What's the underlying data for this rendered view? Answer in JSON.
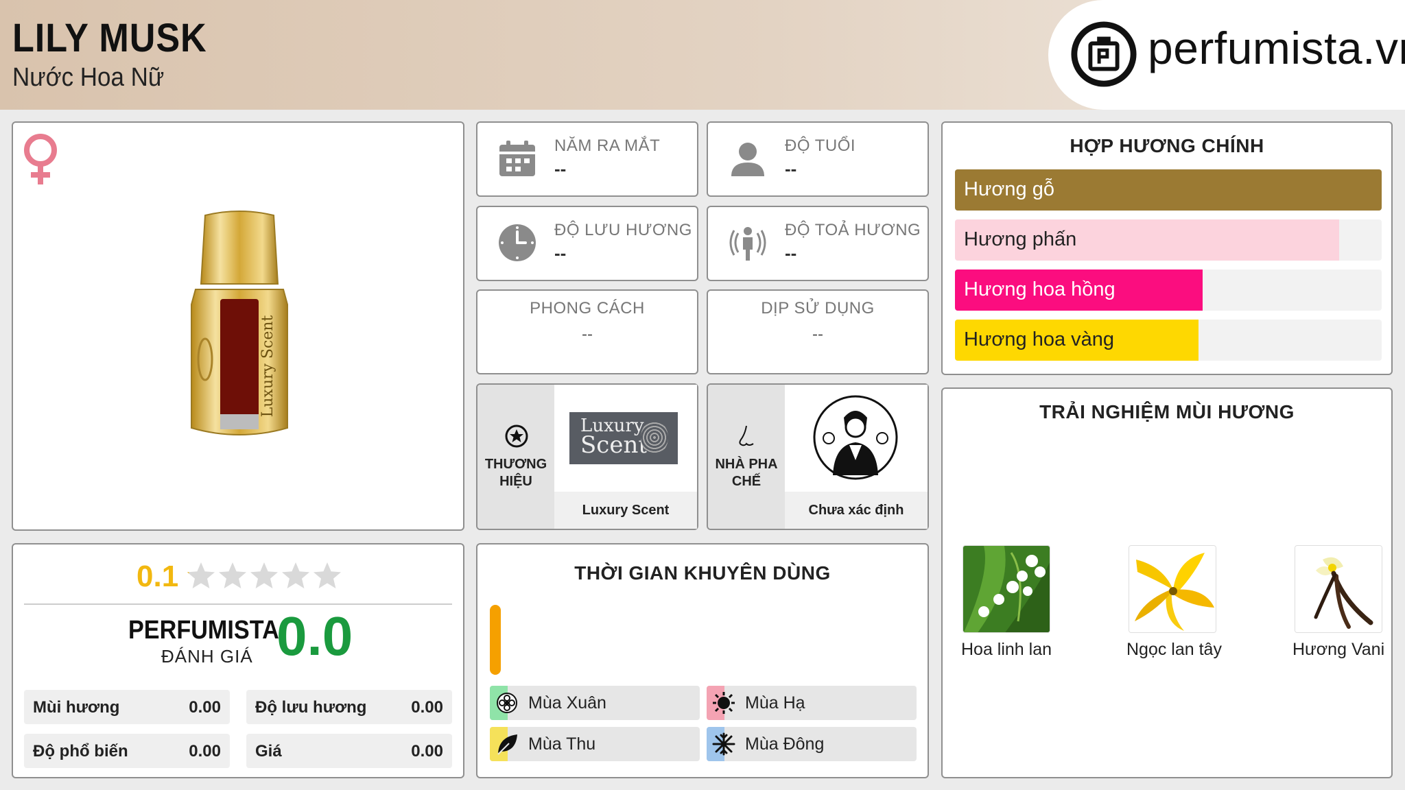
{
  "header": {
    "title": "LILY MUSK",
    "subtitle": "Nước Hoa Nữ",
    "logo_text": "perfumista.vn"
  },
  "product": {
    "gender_icon": "female-symbol-icon",
    "bottle_label": "Luxury Scent"
  },
  "info": {
    "launch_year": {
      "label": "NĂM RA MẮT",
      "value": "--",
      "icon": "calendar-icon"
    },
    "age": {
      "label": "ĐỘ TUỔI",
      "value": "--",
      "icon": "person-icon"
    },
    "longevity": {
      "label": "ĐỘ LƯU HƯƠNG",
      "value": "--",
      "icon": "clock-icon"
    },
    "sillage": {
      "label": "ĐỘ TOẢ HƯƠNG",
      "value": "--",
      "icon": "sillage-person-icon"
    },
    "style": {
      "label": "PHONG CÁCH",
      "value": "--"
    },
    "occasion": {
      "label": "DỊP SỬ DỤNG",
      "value": "--"
    }
  },
  "brand": {
    "label_line1": "THƯƠNG",
    "label_line2": "HIỆU",
    "logo_line1": "Luxury",
    "logo_line2": "Scent",
    "name": "Luxury Scent"
  },
  "perfumer": {
    "label_line1": "NHÀ PHA",
    "label_line2": "CHẾ",
    "name": "Chưa xác định"
  },
  "accords": {
    "title": "HỢP HƯƠNG CHÍNH",
    "items": [
      {
        "label": "Hương gỗ",
        "level": 1.0,
        "color": "#9b7a33",
        "text_color": "#ffffff"
      },
      {
        "label": "Hương phấn",
        "level": 0.9,
        "color": "#fcd3dd",
        "text_color": "#222222"
      },
      {
        "label": "Hương hoa hồng",
        "level": 0.58,
        "color": "#fb0d7f",
        "text_color": "#ffffff"
      },
      {
        "label": "Hương hoa vàng",
        "level": 0.57,
        "color": "#fed801",
        "text_color": "#222222"
      }
    ]
  },
  "notes": {
    "title": "TRẢI NGHIỆM MÙI HƯƠNG",
    "items": [
      {
        "name": "Hoa linh lan"
      },
      {
        "name": "Ngọc lan tây"
      },
      {
        "name": "Hương Vani"
      }
    ]
  },
  "rating": {
    "community_score": "0.1",
    "stars": 0.02,
    "perfumista_label": "PERFUMISTA",
    "review_label": "ĐÁNH GIÁ",
    "perfumista_score": "0.0",
    "stats": [
      {
        "label": "Mùi hương",
        "value": "0.00"
      },
      {
        "label": "Độ lưu hương",
        "value": "0.00"
      },
      {
        "label": "Độ phổ biến",
        "value": "0.00"
      },
      {
        "label": "Giá",
        "value": "0.00"
      }
    ]
  },
  "usage": {
    "title": "THỜI GIAN KHUYÊN DÙNG",
    "bar_color": "#f5a000",
    "seasons": [
      {
        "label": "Mùa Xuân",
        "icon": "flower-icon",
        "color": "#8fe3a8"
      },
      {
        "label": "Mùa Hạ",
        "icon": "sun-icon",
        "color": "#f4a3b3"
      },
      {
        "label": "Mùa Thu",
        "icon": "leaf-icon",
        "color": "#f5e15a"
      },
      {
        "label": "Mùa Đông",
        "icon": "snowflake-icon",
        "color": "#9fc5ec"
      }
    ]
  }
}
